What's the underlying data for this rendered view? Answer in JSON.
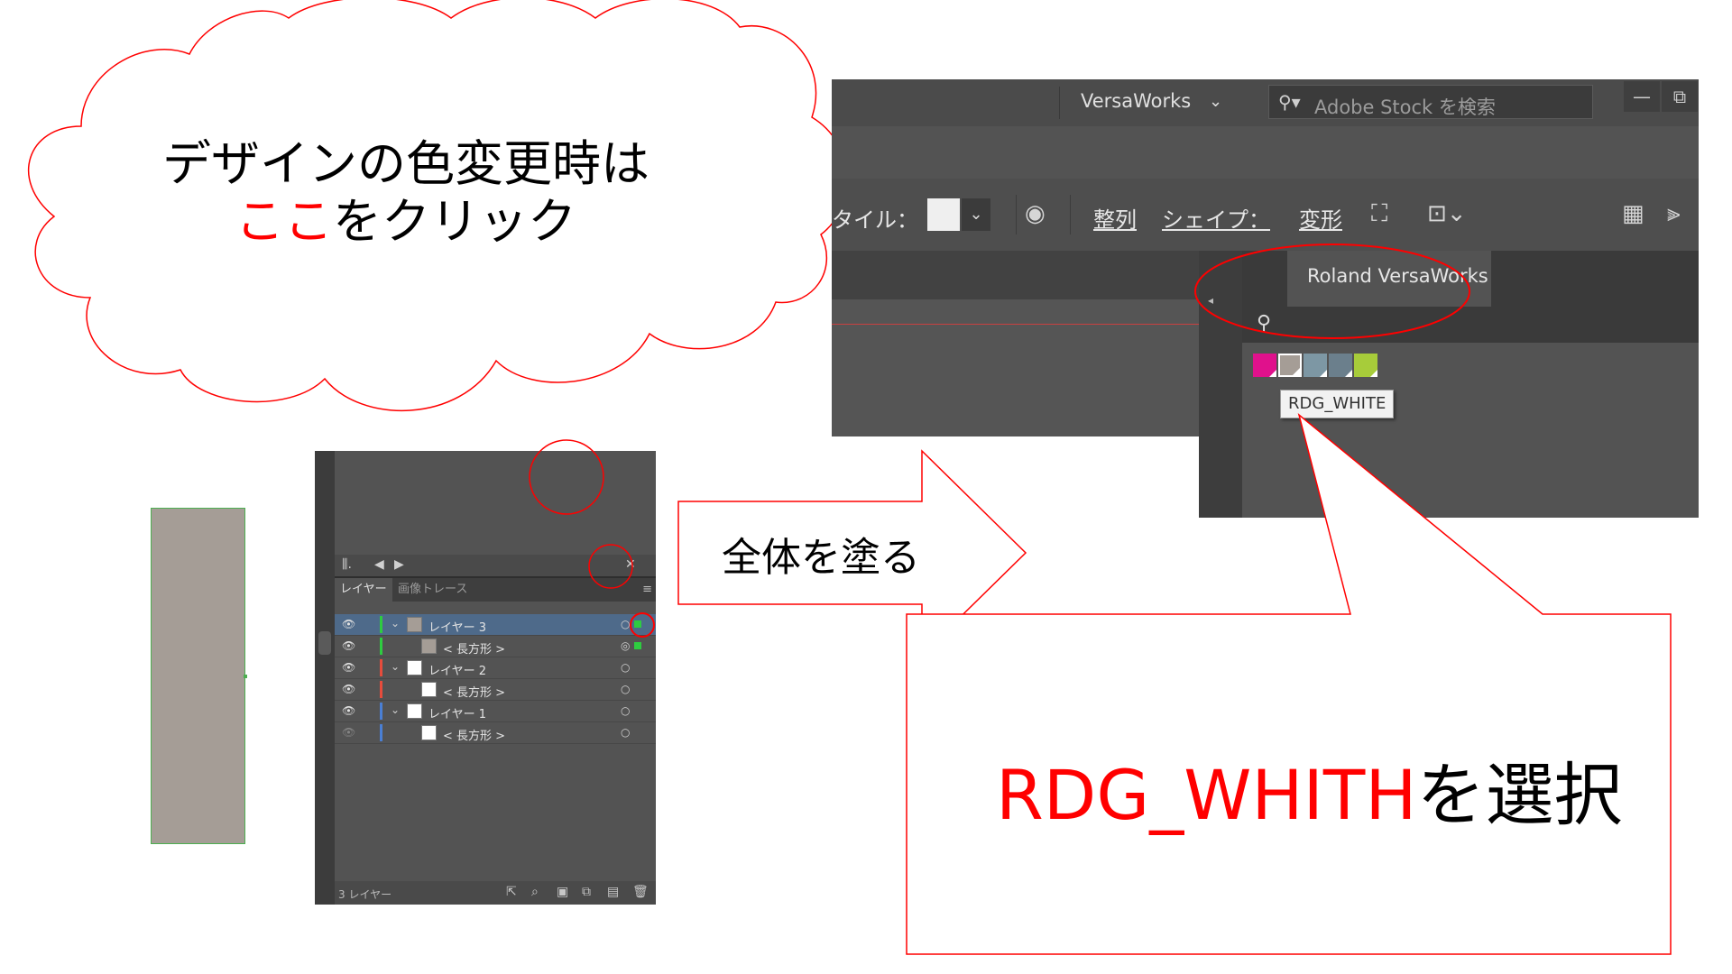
{
  "cloud": {
    "line1": "デザインの色変更時は",
    "line2_highlight": "ここ",
    "line2_rest": "をクリック"
  },
  "arrow": {
    "text": "全体を塗る"
  },
  "callout": {
    "highlight": "RDG_WHITH",
    "rest": "を選択"
  },
  "layers_panel": {
    "tabs": [
      "レイヤー",
      "画像トレース"
    ],
    "rows": [
      {
        "label": "レイヤー 3",
        "color": "#2ecc40",
        "thumb": "#a59d96",
        "expanded": true,
        "selected": true
      },
      {
        "label": "< 長方形 >",
        "color": "#2ecc40",
        "thumb": "#a59d96",
        "child": true
      },
      {
        "label": "レイヤー 2",
        "color": "#e74c3c",
        "thumb": "#ffffff",
        "expanded": true
      },
      {
        "label": "< 長方形 >",
        "color": "#e74c3c",
        "thumb": "#ffffff",
        "child": true
      },
      {
        "label": "レイヤー 1",
        "color": "#4a7fd4",
        "thumb": "#ffffff",
        "expanded": true
      },
      {
        "label": "< 長方形 >",
        "color": "#4a7fd4",
        "thumb": "#ffffff",
        "child": true
      }
    ],
    "footer_count": "3 レイヤー",
    "icons": [
      "export-icon",
      "search-icon",
      "clip-icon",
      "new-sublayer-icon",
      "new-layer-icon",
      "trash-icon"
    ]
  },
  "app": {
    "workspace": "VersaWorks",
    "search_placeholder": "Adobe Stock を検索",
    "control_bar": {
      "style_label": "タイル：",
      "align_label": "整列",
      "shape_label": "シェイプ：",
      "transform_label": "変形"
    },
    "panel_tab": "Roland VersaWorks",
    "swatches": [
      "#e0118c",
      "#a59d96",
      "#7d97a4",
      "#6b7f8c",
      "#a7cc3a"
    ],
    "tooltip": "RDG_WHITE"
  },
  "colors": {
    "accent_red": "#ff0000",
    "panel_bg": "#535353"
  }
}
